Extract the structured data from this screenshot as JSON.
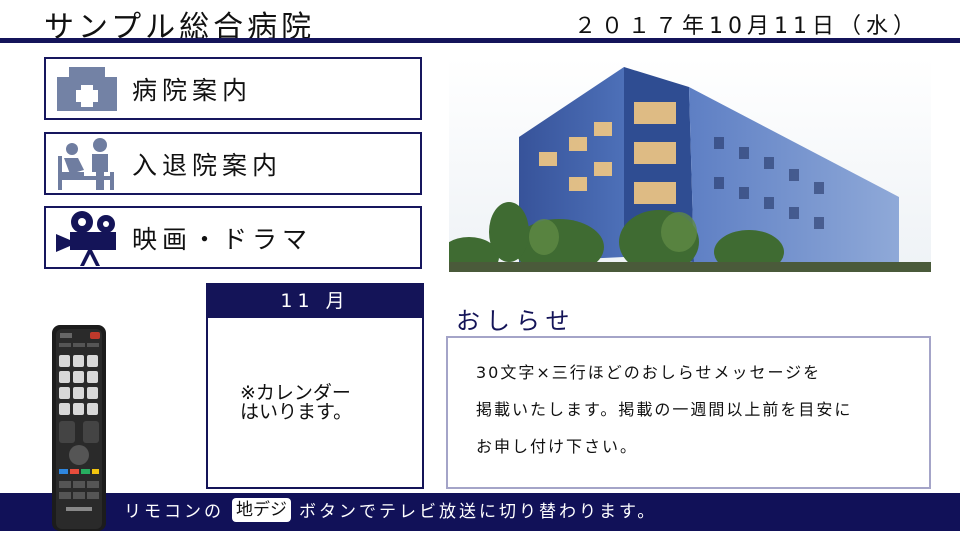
{
  "header": {
    "title": "サンプル総合病院",
    "date": "２０１７年10月11日（水）"
  },
  "menu": [
    {
      "label": "病院案内",
      "icon": "hospital-icon"
    },
    {
      "label": "入退院案内",
      "icon": "patient-bed-icon"
    },
    {
      "label": "映画・ドラマ",
      "icon": "movie-camera-icon"
    }
  ],
  "calendar": {
    "month": "11 月",
    "placeholder": "※カレンダー\nはいります。"
  },
  "notice": {
    "title": "おしらせ",
    "lines": [
      "30文字×三行ほどのおしらせメッセージを",
      "掲載いたします。掲載の一週間以上前を目安に",
      "お申し付け下さい。"
    ]
  },
  "footer": {
    "prefix": "リモコンの",
    "button": "地デジ",
    "suffix": "ボタンでテレビ放送に切り替わります。"
  },
  "colors": {
    "navy": "#141458",
    "icon_gray": "#6f7da0",
    "notice_border": "#a4a4c8"
  }
}
